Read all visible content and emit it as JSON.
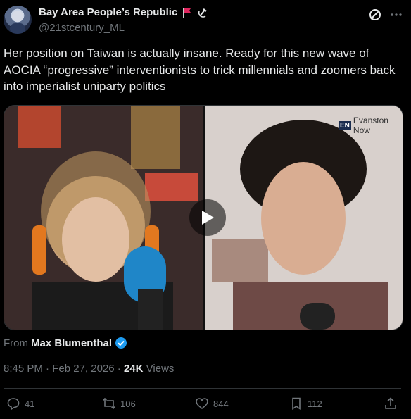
{
  "author": {
    "display_name": "Bay Area People’s Republic",
    "handle": "@21stcentury_ML"
  },
  "tweet": {
    "text": "Her position on Taiwan is actually insane. Ready for this new wave of AOCIA “progressive” interventionists to trick millennials and zoomers back into imperialist uniparty politics"
  },
  "media": {
    "overlay_badge": "Evanston Now",
    "overlay_badge_logo": "EN"
  },
  "attribution": {
    "from_label": "From",
    "from_name": "Max Blumenthal"
  },
  "meta": {
    "time": "8:45 PM",
    "separator": "·",
    "date": "Feb 27, 2026",
    "views_count": "24K",
    "views_label": "Views"
  },
  "actions": {
    "replies": "41",
    "reposts": "106",
    "likes": "844",
    "bookmarks": "112"
  },
  "colors": {
    "background": "#000000",
    "text": "#e7e9ea",
    "muted": "#71767b",
    "verified": "#1d9bf0",
    "flag": "#e0245e"
  }
}
